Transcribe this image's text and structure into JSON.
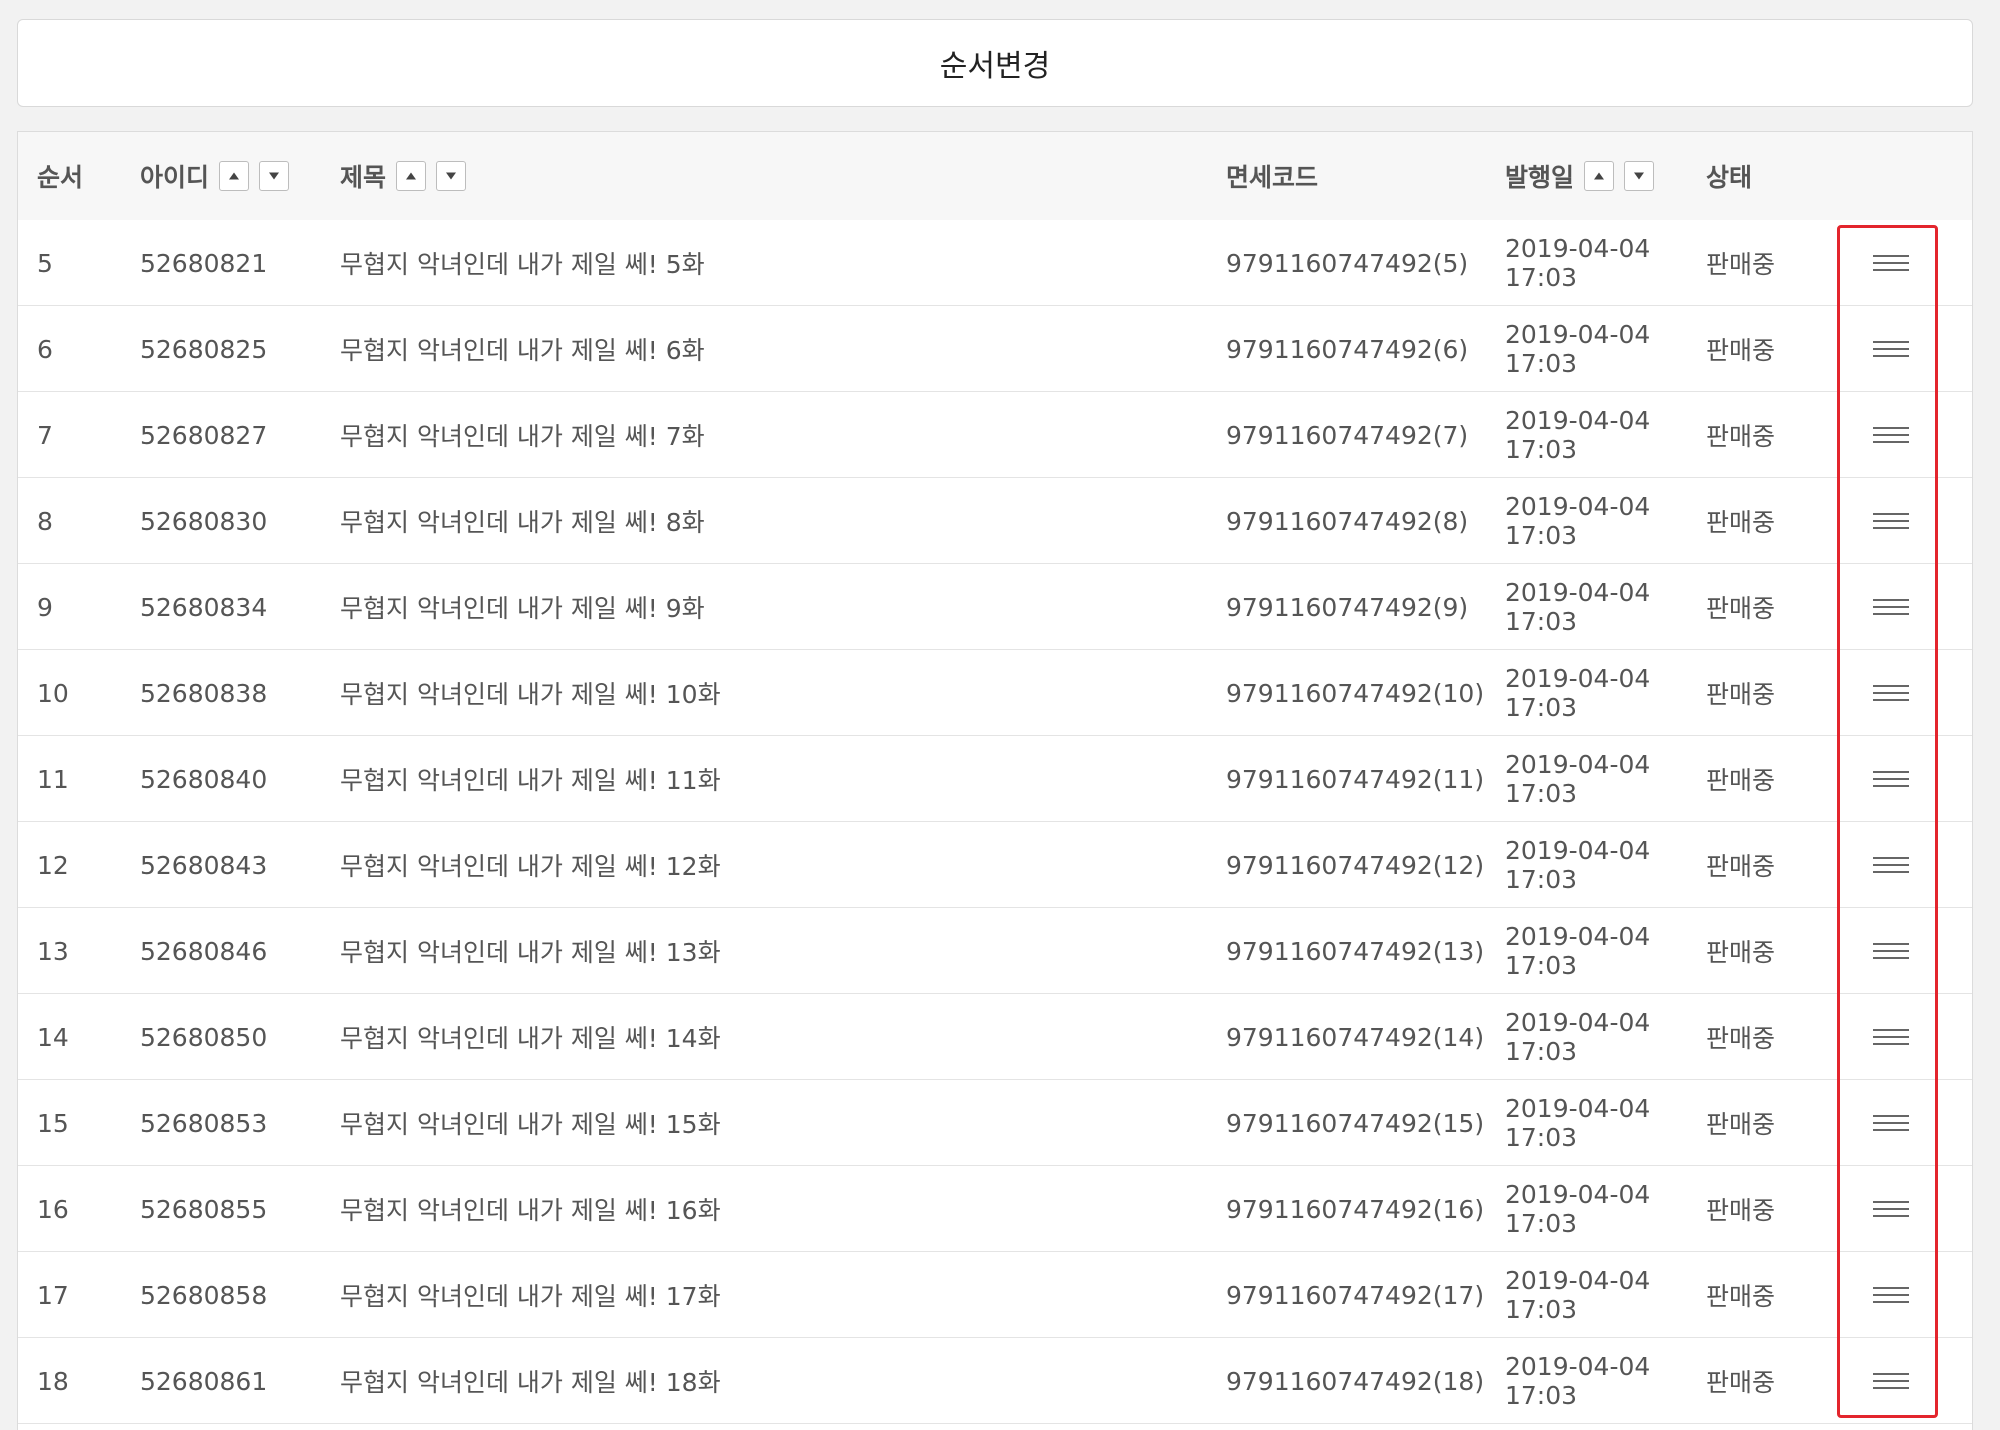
{
  "reorder_button": {
    "label": "순서변경"
  },
  "header": {
    "order": "순서",
    "id": "아이디",
    "title": "제목",
    "code": "면세코드",
    "date": "발행일",
    "status": "상태"
  },
  "icons": {
    "sort_up": "triangle-up-icon",
    "sort_down": "triangle-down-icon",
    "drag": "hamburger-icon"
  },
  "colors": {
    "highlight": "#e3252d"
  },
  "rows": [
    {
      "order": "5",
      "id": "52680821",
      "title": "무협지 악녀인데 내가 제일 쎄! 5화",
      "code": "9791160747492(5)",
      "date": "2019-04-04",
      "time": "17:03",
      "status": "판매중"
    },
    {
      "order": "6",
      "id": "52680825",
      "title": "무협지 악녀인데 내가 제일 쎄! 6화",
      "code": "9791160747492(6)",
      "date": "2019-04-04",
      "time": "17:03",
      "status": "판매중"
    },
    {
      "order": "7",
      "id": "52680827",
      "title": "무협지 악녀인데 내가 제일 쎄! 7화",
      "code": "9791160747492(7)",
      "date": "2019-04-04",
      "time": "17:03",
      "status": "판매중"
    },
    {
      "order": "8",
      "id": "52680830",
      "title": "무협지 악녀인데 내가 제일 쎄! 8화",
      "code": "9791160747492(8)",
      "date": "2019-04-04",
      "time": "17:03",
      "status": "판매중"
    },
    {
      "order": "9",
      "id": "52680834",
      "title": "무협지 악녀인데 내가 제일 쎄! 9화",
      "code": "9791160747492(9)",
      "date": "2019-04-04",
      "time": "17:03",
      "status": "판매중"
    },
    {
      "order": "10",
      "id": "52680838",
      "title": "무협지 악녀인데 내가 제일 쎄! 10화",
      "code": "9791160747492(10)",
      "date": "2019-04-04",
      "time": "17:03",
      "status": "판매중"
    },
    {
      "order": "11",
      "id": "52680840",
      "title": "무협지 악녀인데 내가 제일 쎄! 11화",
      "code": "9791160747492(11)",
      "date": "2019-04-04",
      "time": "17:03",
      "status": "판매중"
    },
    {
      "order": "12",
      "id": "52680843",
      "title": "무협지 악녀인데 내가 제일 쎄! 12화",
      "code": "9791160747492(12)",
      "date": "2019-04-04",
      "time": "17:03",
      "status": "판매중"
    },
    {
      "order": "13",
      "id": "52680846",
      "title": "무협지 악녀인데 내가 제일 쎄! 13화",
      "code": "9791160747492(13)",
      "date": "2019-04-04",
      "time": "17:03",
      "status": "판매중"
    },
    {
      "order": "14",
      "id": "52680850",
      "title": "무협지 악녀인데 내가 제일 쎄! 14화",
      "code": "9791160747492(14)",
      "date": "2019-04-04",
      "time": "17:03",
      "status": "판매중"
    },
    {
      "order": "15",
      "id": "52680853",
      "title": "무협지 악녀인데 내가 제일 쎄! 15화",
      "code": "9791160747492(15)",
      "date": "2019-04-04",
      "time": "17:03",
      "status": "판매중"
    },
    {
      "order": "16",
      "id": "52680855",
      "title": "무협지 악녀인데 내가 제일 쎄! 16화",
      "code": "9791160747492(16)",
      "date": "2019-04-04",
      "time": "17:03",
      "status": "판매중"
    },
    {
      "order": "17",
      "id": "52680858",
      "title": "무협지 악녀인데 내가 제일 쎄! 17화",
      "code": "9791160747492(17)",
      "date": "2019-04-04",
      "time": "17:03",
      "status": "판매중"
    },
    {
      "order": "18",
      "id": "52680861",
      "title": "무협지 악녀인데 내가 제일 쎄! 18화",
      "code": "9791160747492(18)",
      "date": "2019-04-04",
      "time": "17:03",
      "status": "판매중"
    }
  ]
}
